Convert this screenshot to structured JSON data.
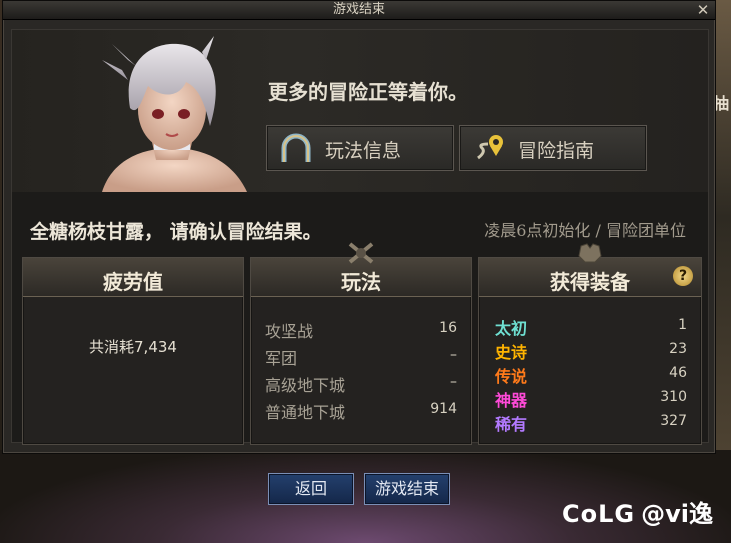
{
  "window": {
    "title": "游戏结束",
    "close_label": "✕"
  },
  "header": {
    "message": "更多的冒险正等着你。"
  },
  "nav_buttons": {
    "rules": "玩法信息",
    "guide": "冒险指南"
  },
  "confirm_text": "全糖杨枝甘露， 请确认冒险结果。",
  "reset_note": "凌晨6点初始化 / 冒险团单位",
  "fatigue": {
    "title": "疲劳值",
    "text": "共消耗7,434"
  },
  "modes": {
    "title": "玩法",
    "rows": [
      {
        "label": "攻坚战",
        "value": "16"
      },
      {
        "label": "军团",
        "value": "–"
      },
      {
        "label": "高级地下城",
        "value": "–"
      },
      {
        "label": "普通地下城",
        "value": "914"
      }
    ]
  },
  "equipment": {
    "title": "获得装备",
    "help_label": "?",
    "rows": [
      {
        "label": "太初",
        "value": "1",
        "color": "#6fe0d2"
      },
      {
        "label": "史诗",
        "value": "23",
        "color": "#ffb400"
      },
      {
        "label": "传说",
        "value": "46",
        "color": "#ff7a1a"
      },
      {
        "label": "神器",
        "value": "310",
        "color": "#ff4ad8"
      },
      {
        "label": "稀有",
        "value": "327",
        "color": "#b37aff"
      }
    ]
  },
  "footer": {
    "back": "返回",
    "end": "游戏结束"
  },
  "watermark": {
    "logo": "CoLG",
    "handle": "@vi逸"
  },
  "side_text": "再抽"
}
